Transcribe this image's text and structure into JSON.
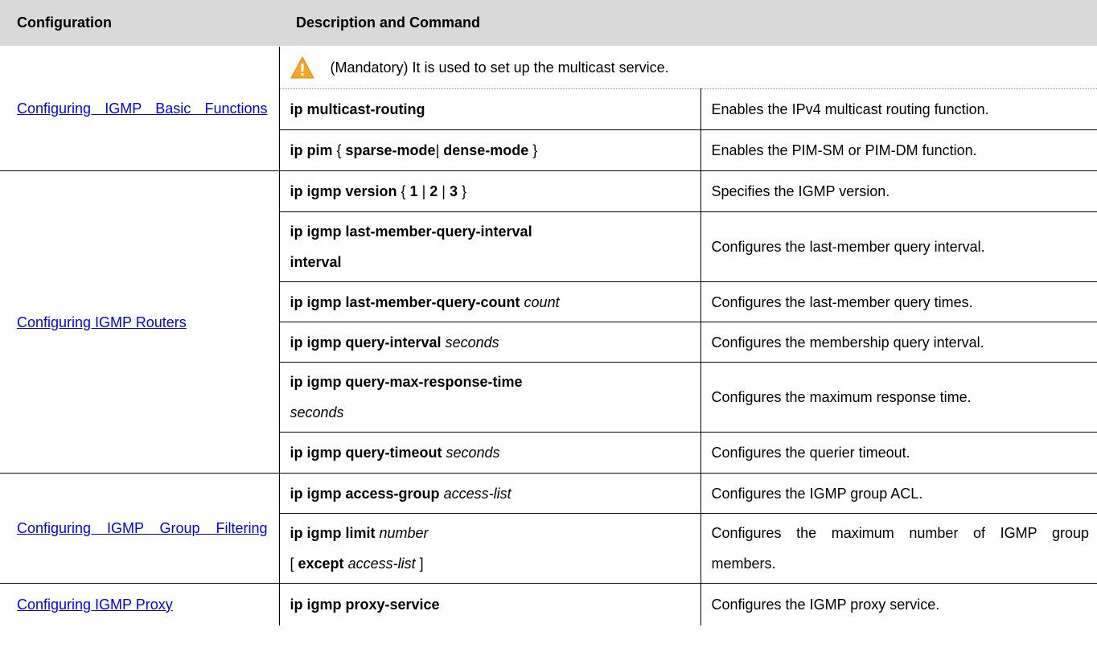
{
  "header": {
    "col1": "Configuration",
    "col2": "Description and Command"
  },
  "groups": [
    {
      "config": "Configuring IGMP Basic Functions",
      "note": "(Mandatory) It is used to set up the multicast service.",
      "note_icon": "warning-icon",
      "rows": [
        {
          "cmd": "ip multicast-routing",
          "desc": "Enables the IPv4 multicast routing function."
        },
        {
          "cmd_parts": {
            "a": "ip pim",
            "b": " { ",
            "c": "sparse-mode",
            "d": "| ",
            "e": "dense-mode",
            "f": " }"
          },
          "desc": "Enables the PIM-SM or PIM-DM function."
        }
      ]
    },
    {
      "config": "Configuring IGMP Routers",
      "rows": [
        {
          "cmd_parts": {
            "a": "ip igmp version",
            "b": " { ",
            "c": "1",
            "d": " | ",
            "e": "2",
            "f": " | ",
            "g": "3",
            "h": " }"
          },
          "desc": "Specifies the IGMP version."
        },
        {
          "cmd_line1": "ip igmp last-member-query-interval",
          "cmd_line2": "interval",
          "desc": "Configures the last-member query interval."
        },
        {
          "cmd": "ip igmp last-member-query-count",
          "arg": "count",
          "desc": "Configures the last-member query times."
        },
        {
          "cmd": "ip igmp query-interval",
          "arg": "seconds",
          "desc": "Configures the membership query interval."
        },
        {
          "cmd_line1": "ip igmp query-max-response-time",
          "cmd_line2": "seconds",
          "desc": "Configures the maximum response time."
        },
        {
          "cmd": "ip igmp query-timeout",
          "arg": "seconds",
          "desc": "Configures the querier timeout."
        }
      ]
    },
    {
      "config": "Configuring IGMP Group Filtering",
      "rows": [
        {
          "cmd": "ip igmp access-group",
          "arg": "access-list",
          "desc": "Configures the IGMP group ACL."
        },
        {
          "cmd": "ip igmp limit",
          "arg": "number",
          "line2_a": "[ ",
          "line2_b": "except",
          "line2_c": "access-list",
          "line2_d": " ]",
          "desc": "Configures the maximum number of IGMP group members."
        }
      ]
    },
    {
      "config": "Configuring IGMP Proxy",
      "rows": [
        {
          "cmd": "ip igmp proxy-service",
          "desc": "Configures the IGMP proxy service."
        }
      ]
    }
  ],
  "colors": {
    "header_bg": "#d9d9d9",
    "link": "#0000ee",
    "warning": "#f5a623"
  }
}
